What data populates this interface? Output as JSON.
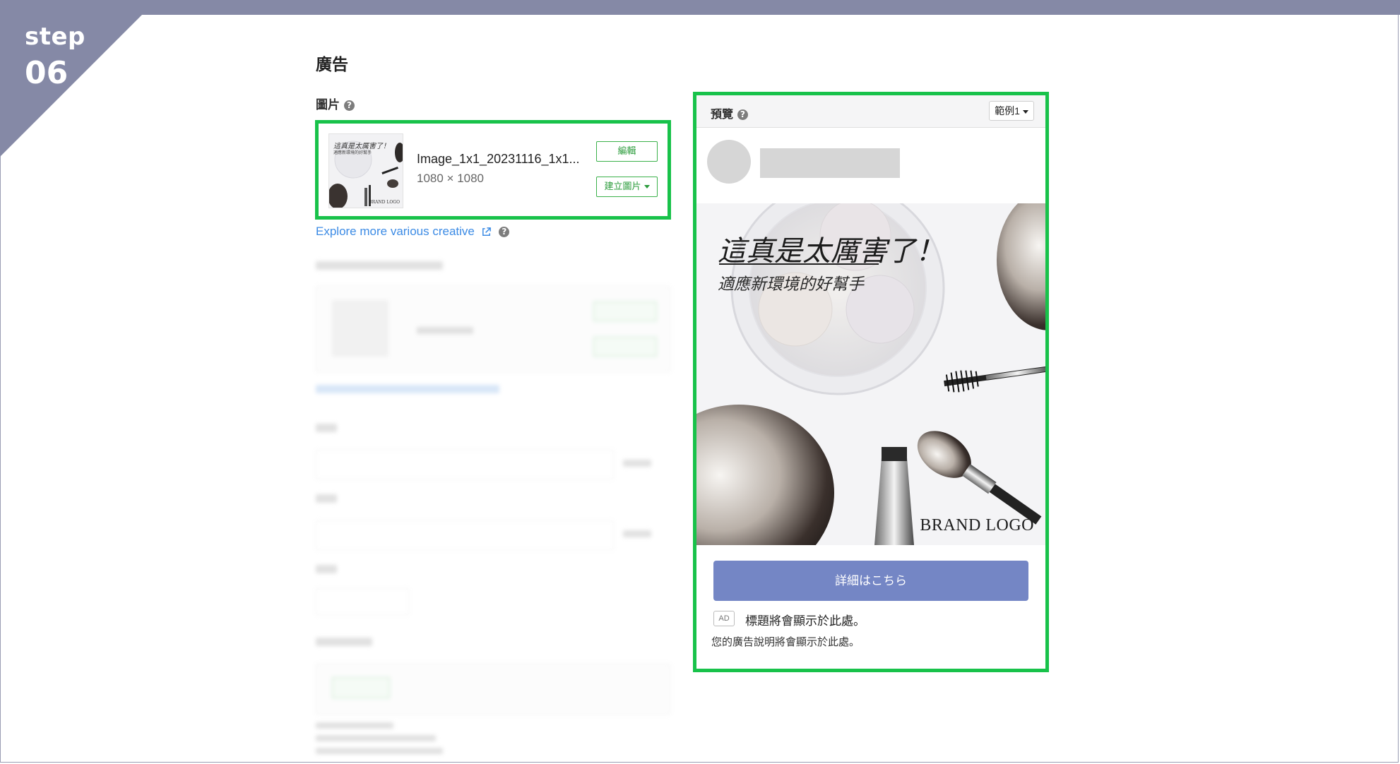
{
  "step": {
    "word": "step",
    "number": "06"
  },
  "section": {
    "title": "廣告",
    "image_label": "圖片"
  },
  "image_card": {
    "file_name": "Image_1x1_20231116_1x1...",
    "dimensions": "1080 × 1080",
    "edit_label": "編輯",
    "create_label": "建立圖片",
    "thumb_title": "這真是太厲害了！",
    "thumb_subtitle": "適應新環境的好幫手",
    "thumb_logo": "BRAND LOGO"
  },
  "explore_link": "Explore more various creative",
  "preview": {
    "title": "預覽",
    "example_select": "範例1",
    "hero_title": "這真是太厲害了！",
    "hero_subtitle": "適應新環境的好幫手",
    "brand_logo": "BRAND LOGO",
    "cta": "詳細はこちら",
    "ad_badge": "AD",
    "ad_headline": "標題將會顯示於此處。",
    "ad_description": "您的廣告說明將會顯示於此處。"
  },
  "colors": {
    "highlight": "#18c24a",
    "step_banner": "#8589a6",
    "cta": "#7486c5",
    "link": "#3c8be5",
    "outline_button": "#3bb14a"
  },
  "icons": [
    "help-icon",
    "external-link-icon",
    "caret-down-icon"
  ]
}
